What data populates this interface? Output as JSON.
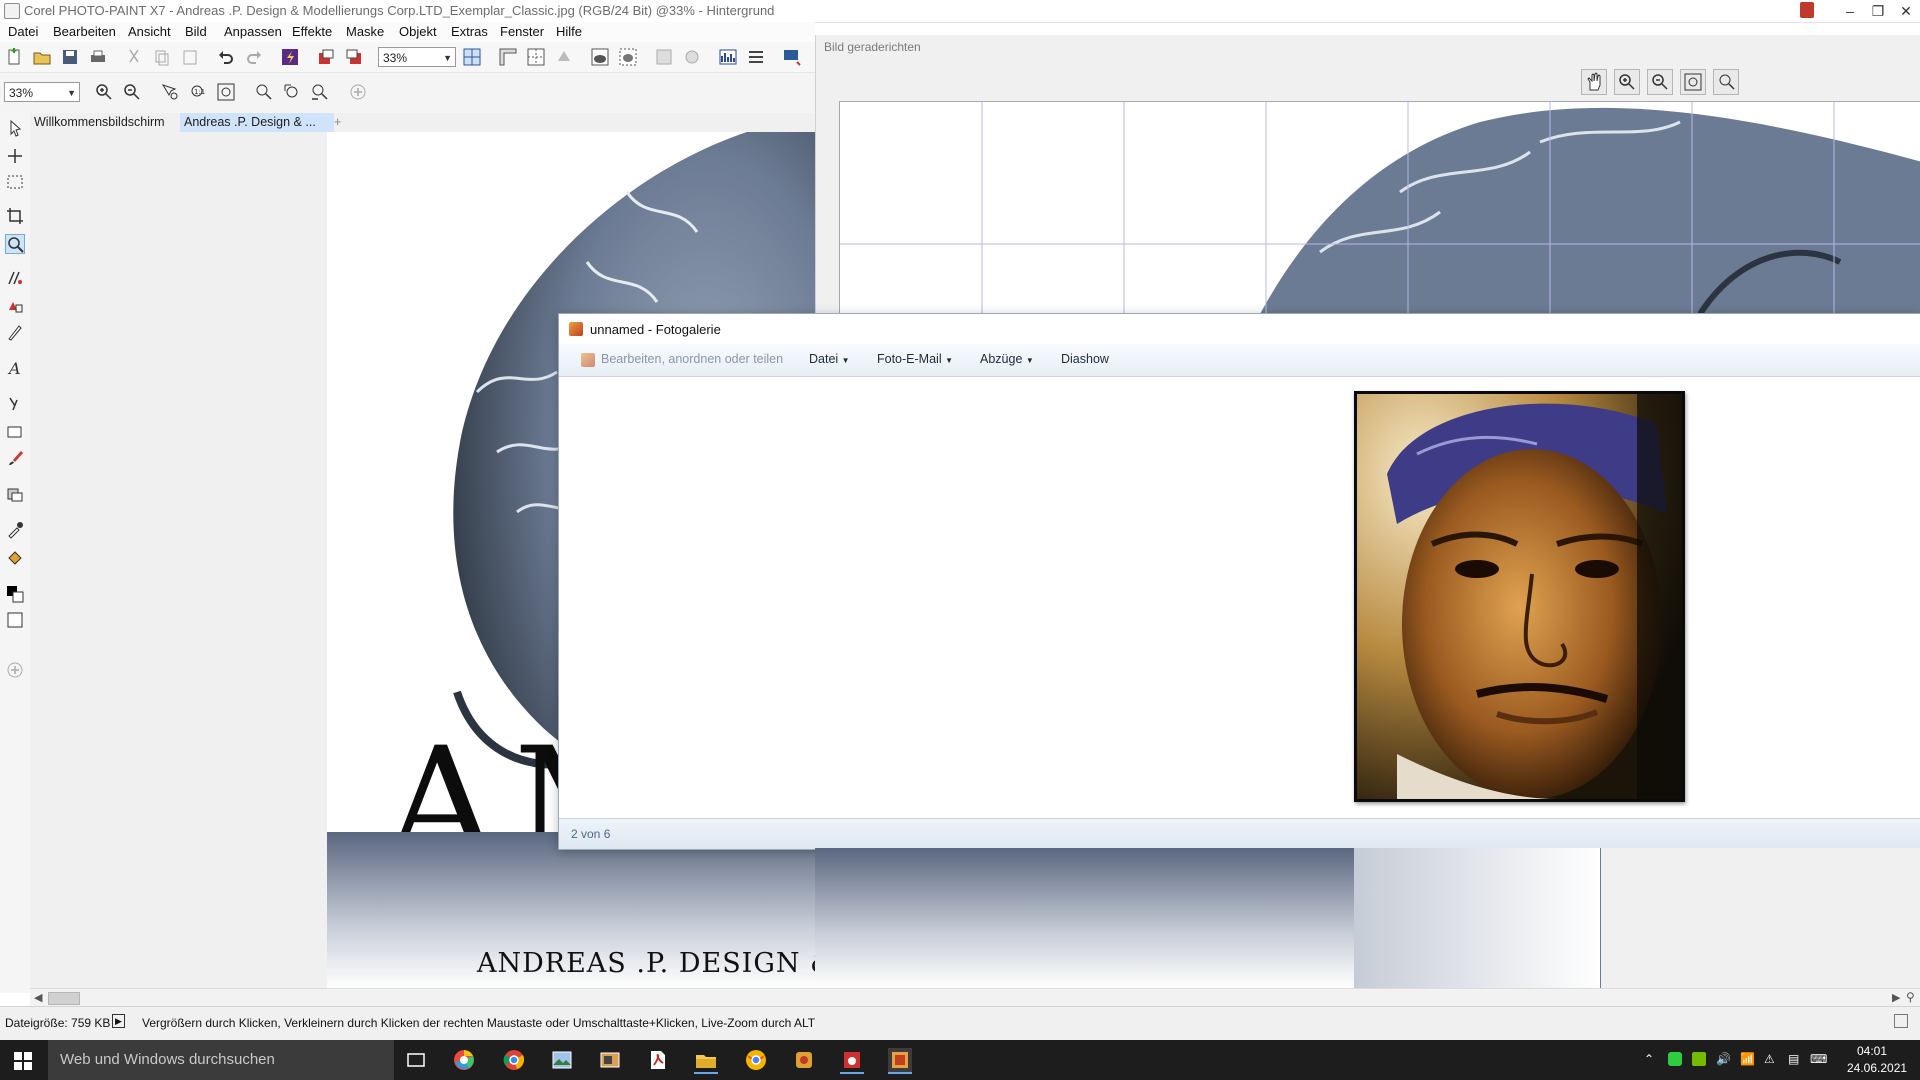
{
  "window": {
    "title": "Corel PHOTO-PAINT X7 - Andreas .P. Design & Modellierungs Corp.LTD_Exemplar_Classic.jpg (RGB/24 Bit) @33% - Hintergrund",
    "minimize_glyph": "–",
    "restore_glyph": "❐",
    "close_glyph": "✕"
  },
  "menu": {
    "items": [
      "Datei",
      "Bearbeiten",
      "Ansicht",
      "Bild",
      "Anpassen",
      "Effekte",
      "Maske",
      "Objekt",
      "Extras",
      "Fenster",
      "Hilfe"
    ]
  },
  "toolbar": {
    "zoom_value": "33%",
    "zoom2_value": "33%"
  },
  "tabs": {
    "items": [
      "Willkommensbildschirm",
      "Andreas .P. Design & ..."
    ],
    "add_glyph": "+"
  },
  "canvas": {
    "headline": "AMARU",
    "subline": "ANDREAS .P. DESIGN & MODELLIERUNGS CORP.LTD"
  },
  "straighten": {
    "header": "Bild geraderichten"
  },
  "gallery": {
    "title": "unnamed - Fotogalerie",
    "menu": [
      "Bearbeiten, anordnen oder teilen",
      "Datei",
      "Foto-E-Mail",
      "Abzüge",
      "Diashow"
    ],
    "status": "2 von 6"
  },
  "status": {
    "filesize": "Dateigröße: 759 KB",
    "hint": "Vergrößern durch Klicken, Verkleinern durch Klicken der rechten Maustaste oder Umschalttaste+Klicken, Live-Zoom durch ALT"
  },
  "taskbar": {
    "search_placeholder": "Web und Windows durchsuchen",
    "time": "04:01",
    "date": "24.06.2021"
  },
  "colors": {
    "accent": "#3a6ea5",
    "taskbar": "#1d1d1d",
    "gallery_bar": "#e7eef7",
    "photo_tint": "#6c7b94"
  }
}
